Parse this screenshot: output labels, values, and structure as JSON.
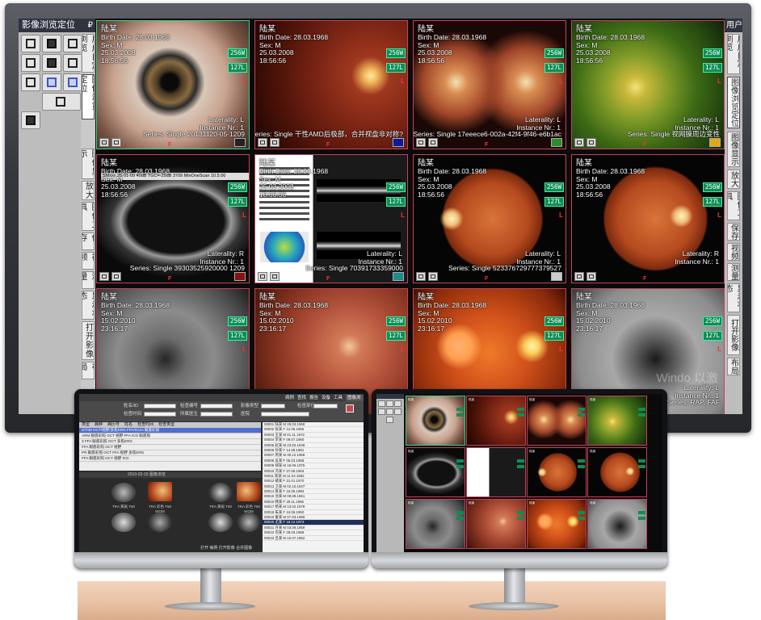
{
  "left_panel": {
    "title": "影像浏览定位",
    "pin": "₽",
    "tabs": [
      "用户自定浏览",
      "图像浏览定位",
      "图像显示",
      "放大",
      "图像工具",
      "保存",
      "视频",
      "测量",
      "显示状态",
      "打开影像",
      "布局"
    ]
  },
  "right_panel": {
    "title": "用户",
    "tabs": [
      "用户自定浏览",
      "图像浏览定位",
      "图像显示",
      "放大",
      "图像工具",
      "保存",
      "视频",
      "测量",
      "显示状态",
      "打开影像",
      "布局"
    ]
  },
  "zoom_labels": {
    "a": "256W",
    "b": "127L"
  },
  "laterality_flag": "L",
  "frame_flag": "F",
  "cells": [
    {
      "name": "陆某",
      "birth": "Birth Date: 28.03.1968",
      "sex": "Sex: M",
      "date": "25.03.2008",
      "time": "18:56:56",
      "laterality": "Laterality: L",
      "instance": "Instance Nr.: 1",
      "series": "Series: Single 20131120-05-1209",
      "swatch": "#222222",
      "lat": "L",
      "selected": true,
      "img": "eye"
    },
    {
      "name": "陆某",
      "birth": "Birth Date: 28.03.1968",
      "sex": "Sex: M",
      "date": "25.03.2008",
      "time": "18:56:56",
      "laterality": "",
      "instance": "",
      "series": "Series: Single 干性AMD后极部，合并视盘非对称?",
      "swatch": "#0a1a9a",
      "lat": "L",
      "selected": false,
      "img": "fundus_red"
    },
    {
      "name": "陆某",
      "birth": "Birth Date: 28.03.1968",
      "sex": "Sex: M",
      "date": "25.03.2008",
      "time": "18:56:56",
      "laterality": "Laterality: L",
      "instance": "Instance Nr.: 1",
      "series": "Series: Single 17eeece6-002a-42f4-9f46-e6b1ac",
      "swatch": "#2a8f2a",
      "lat": "L",
      "selected": false,
      "img": "stereo"
    },
    {
      "name": "陆某",
      "birth": "Birth Date: 28.03.1968",
      "sex": "Sex: M",
      "date": "25.03.2008",
      "time": "18:56:56",
      "laterality": "Laterality: L",
      "instance": "Instance Nr.: 1",
      "series": "Series: Single 视网膜周边变性",
      "swatch": "#e2a51a",
      "lat": "L",
      "selected": false,
      "img": "widefield"
    },
    {
      "name": "陆某",
      "birth": "Birth Date: 28.03.1968",
      "sex": "Sex: M",
      "date": "25.03.2008",
      "time": "18:56:56",
      "laterality": "Laterality: R",
      "instance": "Instance Nr.: 1",
      "series": "Series: Single 39303525920000 1209",
      "swatch": "#8a1010",
      "lat": "L",
      "selected": false,
      "img": "ultrasound",
      "device_text": "SMxxx 26-01-09 40dB TGC=-25dB 3709 MinOneScan 10.5.06"
    },
    {
      "name": "陆某",
      "birth": "Birth Date: 28.03.1968",
      "sex": "Sex: M",
      "date": "25.03.2008",
      "time": "18:56:56",
      "laterality": "Laterality: L",
      "instance": "Instance Nr.: 1",
      "series": "Series: Single 70391733359000",
      "swatch": "#1a8c8c",
      "lat": "L",
      "selected": false,
      "img": "oct"
    },
    {
      "name": "陆某",
      "birth": "Birth Date: 28.03.1968",
      "sex": "Sex: M",
      "date": "25.03.2008",
      "time": "18:56:56",
      "laterality": "Laterality: L",
      "instance": "Instance Nr.: 1",
      "series": "Series: Single 523376729777379527",
      "swatch": "#cccccc",
      "lat": "L",
      "selected": false,
      "img": "fundus_orange"
    },
    {
      "name": "陆某",
      "birth": "Birth Date: 28.03.1968",
      "sex": "Sex: M",
      "date": "25.03.2008",
      "time": "18:56:56",
      "laterality": "Laterality: R",
      "instance": "Instance Nr.: 1",
      "series": "",
      "swatch": "",
      "lat": "L",
      "selected": false,
      "img": "fundus_orange2"
    },
    {
      "name": "陆某",
      "birth": "Birth Date: 28.03.1968",
      "sex": "Sex: M",
      "date": "15.02.2010",
      "time": "23:16:17",
      "laterality": "",
      "instance": "",
      "series": "",
      "swatch": "",
      "lat": "L",
      "selected": false,
      "img": "gray"
    },
    {
      "name": "陆某",
      "birth": "Birth Date: 28.03.1968",
      "sex": "Sex: M",
      "date": "15.02.2010",
      "time": "23:16:17",
      "laterality": "",
      "instance": "",
      "series": "",
      "swatch": "",
      "lat": "L",
      "selected": false,
      "img": "fundus_red2"
    },
    {
      "name": "陆某",
      "birth": "Birth Date: 28.03.1968",
      "sex": "Sex: M",
      "date": "15.02.2010",
      "time": "23:16:17",
      "laterality": "",
      "instance": "",
      "series": "",
      "swatch": "",
      "lat": "L",
      "selected": false,
      "img": "fundus_bright"
    },
    {
      "name": "陆某",
      "birth": "Birth Date: 28.03.1968",
      "sex": "Sex: M",
      "date": "15.02.2010",
      "time": "23:16:17",
      "laterality": "Laterality: L",
      "instance": "Instance Nr.: 1",
      "series": "Series: RAP, FAF",
      "swatch": "",
      "lat": "L",
      "selected": false,
      "img": "gray2"
    }
  ],
  "watermark": "Windo 以激",
  "left_small": {
    "tabs": [
      "病例",
      "查找",
      "报告",
      "设备",
      "工具",
      "系统",
      "图像浏览"
    ],
    "form_labels": [
      "姓名/ID",
      "检查编号",
      "检查时间",
      "所属医生",
      "影像类型",
      "检查部位",
      "医院"
    ],
    "list_headers": [
      "类型",
      "病种",
      "病历号",
      "姓名",
      "检查时间",
      "检查类型"
    ],
    "rows": [
      "2/7/48 OCT/视野/多焦ERG FFA/ICGA 眼底彩照",
      "ARM 眼底彩照 OCT 视野 FFA ICG 眼底照",
      "3 FFA 眼底彩照 OCT 多焦ERG",
      "FFA 眼底彩照 OCT 视野",
      "PR 眼底彩照 OCT FFA 视野 多焦ERG",
      "FFA 眼底彩照 OCT 视野 ICG"
    ],
    "thumbs_bar": "2010-02-15 图像浏览",
    "side_rows": [
      "00001 陆某 M 28.03.1968",
      "00002 张某 F 12.05.1955",
      "00003 王某 M 01.11.1972",
      "00004 李某 F 09.07.1960",
      "00005 赵某 M 23.02.1949",
      "00006 孙某 F 14.08.1981",
      "00007 周某 M 30.12.1966",
      "00008 吴某 F 05.03.1958",
      "00009 郑某 M 18.06.1975",
      "00010 冯某 F 27.09.1963",
      "00011 陈某 M 11.04.1952",
      "00012 褚某 F 21.01.1970",
      "00013 卫某 M 02.10.1947",
      "00014 蒋某 F 16.05.1984",
      "00015 沈某 M 08.08.1961",
      "00016 韩某 F 29.11.1956",
      "00017 杨某 M 13.02.1979",
      "00018 朱某 F 24.06.1950",
      "00019 秦某 M 07.03.1968",
      "00020 尤某 F 19.12.1973",
      "00021 许某 M 03.09.1959",
      "00022 何某 F 28.03.1968",
      "00023 吕某 M 10.07.1962"
    ],
    "captions": [
      "TRA 黄斑 T60",
      "TRA 彩色 T60 WOM",
      "TRA 黄斑 T60",
      "TRA 彩色 T60 WOM"
    ],
    "bottom": "打开 病例 打开影像 合并图像"
  },
  "right_small": {
    "label": "陆某"
  },
  "colors": {
    "bezel": "#2c2f34",
    "accent_green": "#37d489",
    "accent_red": "#c5435a",
    "zoom_bg": "#0e8e57"
  }
}
